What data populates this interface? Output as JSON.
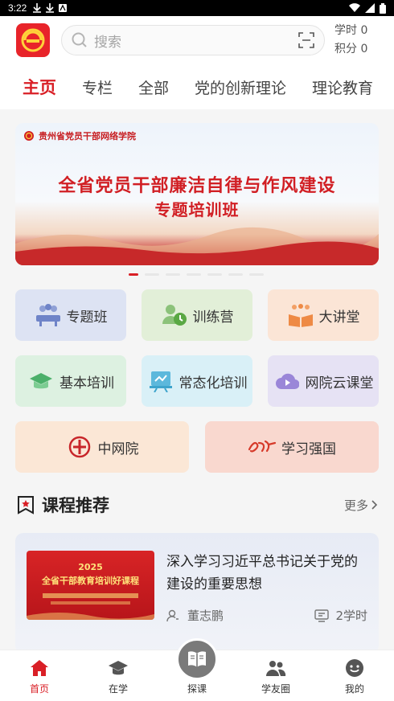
{
  "status_bar": {
    "time": "3:22"
  },
  "header": {
    "search_placeholder": "搜索",
    "study_hours": "学时 0",
    "points": "积分 0"
  },
  "tabs": [
    "主页",
    "专栏",
    "全部",
    "党的创新理论",
    "理论教育"
  ],
  "banner": {
    "org": "贵州省党员干部网络学院",
    "title_line1": "全省党员干部廉洁自律与作风建设",
    "title_line2": "专题培训班"
  },
  "quick_entries": {
    "zhuantiban": "专题班",
    "xunlianying": "训练营",
    "dajiangtang": "大讲堂",
    "jibenpeixun": "基本培训",
    "changtaihua": "常态化培训",
    "wangyuan": "网院云课堂",
    "zhongwangyuan": "中网院",
    "xuexiqiangguo": "学习强国"
  },
  "section": {
    "title": "课程推荐",
    "more": "更多"
  },
  "course": {
    "thumb_year": "2025",
    "thumb_title": "全省干部教育培训好课程",
    "title": "深入学习习近平总书记关于党的建设的重要思想",
    "teacher": "董志鹏",
    "hours": "2学时"
  },
  "bottom_nav": {
    "home": "首页",
    "studying": "在学",
    "explore": "探课",
    "circle": "学友圈",
    "mine": "我的"
  },
  "colors": {
    "brand_red": "#d91f26",
    "zhuantiban_bg": "#dde3f3",
    "xunlianying_bg": "#e2efd8",
    "dajiangtang_bg": "#fbe5d6",
    "jibenpeixun_bg": "#ddf1e1",
    "changtaihua_bg": "#d9f0f7",
    "wangyuan_bg": "#e6e2f4",
    "zhongwangyuan_bg": "#fbe7d6",
    "xuexiqiangguo_bg": "#f9d8cf"
  }
}
